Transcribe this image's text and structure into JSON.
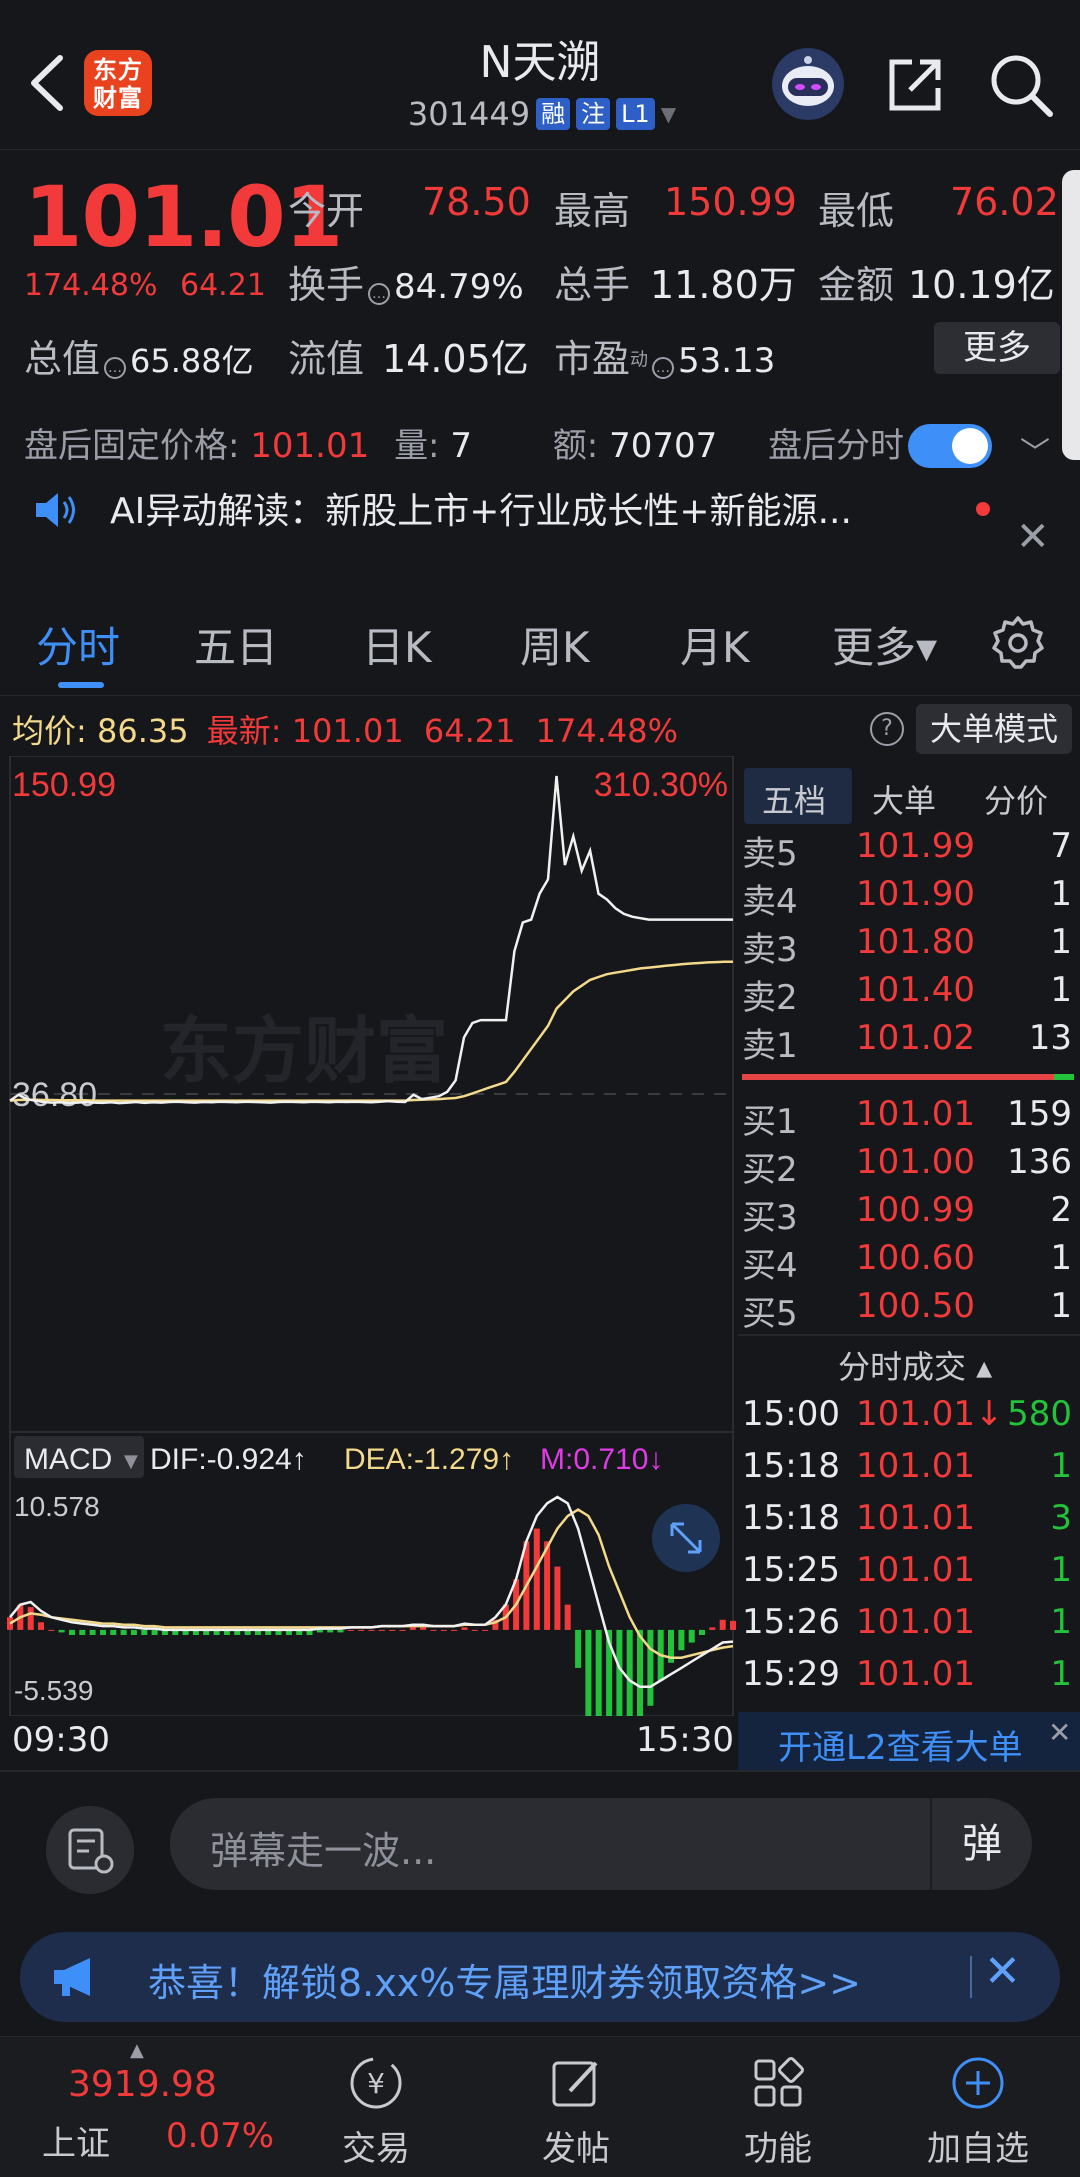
{
  "header": {
    "logo_text": "东方\n财富",
    "stock_name": "N天溯",
    "stock_code": "301449",
    "tags": [
      "融",
      "注",
      "L1"
    ]
  },
  "quote": {
    "price": "101.01",
    "change_pct": "174.48%",
    "change_abs": "64.21",
    "open_label": "今开",
    "open": "78.50",
    "high_label": "最高",
    "high": "150.99",
    "low_label": "最低",
    "low": "76.02",
    "turnover_label": "换手",
    "turnover": "84.79%",
    "volume_label": "总手",
    "volume": "11.80万",
    "amount_label": "金额",
    "amount": "10.19亿",
    "mktcap_label": "总值",
    "mktcap": "65.88亿",
    "float_label": "流值",
    "float": "14.05亿",
    "pe_label": "市盈",
    "pe_sup": "动",
    "pe": "53.13",
    "more_label": "更多"
  },
  "after_hours": {
    "price_label": "盘后固定价格:",
    "price": "101.01",
    "vol_label": "量:",
    "vol": "7",
    "amt_label": "额:",
    "amt": "70707",
    "toggle_label": "盘后分时",
    "toggle_on": true
  },
  "ai": {
    "text": "AI异动解读：新股上市+行业成长性+新能源..."
  },
  "tabs": [
    {
      "label": "分时",
      "active": true
    },
    {
      "label": "五日"
    },
    {
      "label": "日K"
    },
    {
      "label": "周K"
    },
    {
      "label": "月K"
    },
    {
      "label": "更多▾"
    }
  ],
  "avg_row": {
    "avg_label": "均价:",
    "avg": "86.35",
    "latest_label": "最新:",
    "latest": "101.01",
    "latest_chg": "64.21",
    "latest_pct": "174.48%",
    "help": "?",
    "bigorder_label": "大单模式"
  },
  "chart_data": {
    "type": "line",
    "price_top": "150.99",
    "pct_top": "310.30%",
    "price_mid": "36.80",
    "watermark": "东方财富",
    "time_start": "09:30",
    "time_end": "15:30",
    "macd_label": "MACD",
    "dif": "DIF:-0.924↑",
    "dea": "DEA:-1.279↑",
    "m": "M:0.710↓",
    "macd_top": "10.578",
    "macd_bottom": "-5.539",
    "price_series": [
      38,
      40,
      38.5,
      38,
      37.5,
      37.3,
      37.4,
      37.2,
      37.3,
      37.5,
      37.3,
      37.2,
      37.4,
      37.1,
      37.3,
      37.5,
      37.2,
      37.4,
      37.3,
      37.5,
      37.6,
      37.4,
      37.3,
      37.5,
      37.4,
      37.6,
      37.5,
      37.4,
      37.6,
      37.5,
      37.4,
      37.3,
      37.5,
      37.6,
      37.5,
      37.4,
      37.6,
      37.5,
      37.4,
      37.6,
      37.5,
      37.6,
      37.5,
      37.4,
      37.6,
      37.8,
      37.6,
      37.5,
      40,
      38.5,
      39,
      39.5,
      41,
      45,
      60,
      65,
      66,
      66,
      66,
      66,
      90,
      100,
      101,
      110,
      115,
      150.99,
      120,
      130,
      118,
      125,
      110,
      108,
      105,
      103,
      102,
      101.5,
      101,
      101,
      101,
      101,
      101,
      101,
      101,
      101,
      101,
      101,
      101.01
    ],
    "avg_series": [
      38,
      38.2,
      38.3,
      38.3,
      38.2,
      38.2,
      38.1,
      38.1,
      38.1,
      38.1,
      38,
      38,
      38,
      38,
      38,
      38,
      38,
      38,
      38,
      38,
      38,
      38,
      38,
      38,
      38,
      38,
      38,
      38,
      38,
      38,
      38,
      38,
      38,
      38,
      38,
      38,
      38,
      38,
      38,
      38,
      38,
      38,
      38,
      38,
      38,
      38,
      38,
      38,
      38.2,
      38.3,
      38.4,
      38.5,
      38.7,
      38.9,
      39.5,
      40.5,
      41.5,
      42.5,
      43.5,
      44.5,
      48,
      52,
      56,
      60,
      64,
      70,
      73,
      76,
      78,
      80,
      81,
      82,
      82.5,
      83,
      83.5,
      84,
      84.3,
      84.6,
      84.9,
      85.2,
      85.5,
      85.7,
      85.9,
      86.1,
      86.2,
      86.3,
      86.35
    ],
    "dif_series": [
      1,
      2,
      2.2,
      1.5,
      1,
      0.8,
      0.6,
      0.5,
      0.4,
      0.3,
      0.3,
      0.2,
      0.2,
      0.1,
      0.1,
      0,
      0,
      0,
      0,
      0,
      0,
      0,
      0,
      0,
      0,
      0,
      0,
      0,
      0,
      0,
      0.1,
      0.1,
      0.1,
      0.2,
      0.2,
      0.2,
      0.3,
      0.3,
      0.3,
      0.4,
      0.4,
      0.3,
      0.3,
      0.3,
      0.5,
      0.4,
      0.4,
      1,
      2,
      4,
      7,
      9,
      10,
      10.5,
      10,
      8,
      5,
      2,
      -1,
      -3,
      -4,
      -4.5,
      -4.5,
      -4,
      -3.5,
      -3,
      -2.5,
      -2,
      -1.5,
      -1,
      -0.924
    ],
    "dea_series": [
      0.5,
      1,
      1.3,
      1.2,
      1,
      0.9,
      0.8,
      0.7,
      0.6,
      0.5,
      0.5,
      0.4,
      0.4,
      0.3,
      0.3,
      0.2,
      0.2,
      0.2,
      0.2,
      0.2,
      0.2,
      0.2,
      0.2,
      0.2,
      0.2,
      0.2,
      0.2,
      0.2,
      0.2,
      0.2,
      0.2,
      0.2,
      0.2,
      0.2,
      0.2,
      0.2,
      0.3,
      0.3,
      0.3,
      0.3,
      0.3,
      0.3,
      0.3,
      0.3,
      0.4,
      0.4,
      0.4,
      0.6,
      1,
      2,
      3.5,
      5,
      6.5,
      8,
      9,
      9.5,
      9,
      7.5,
      5,
      3,
      1,
      -0.5,
      -1.5,
      -2,
      -2.2,
      -2.2,
      -2,
      -1.8,
      -1.6,
      -1.4,
      -1.279
    ]
  },
  "order_book": {
    "tabs": [
      "五档",
      "大单",
      "分价"
    ],
    "asks": [
      {
        "label": "卖5",
        "price": "101.99",
        "vol": "7"
      },
      {
        "label": "卖4",
        "price": "101.90",
        "vol": "1"
      },
      {
        "label": "卖3",
        "price": "101.80",
        "vol": "1"
      },
      {
        "label": "卖2",
        "price": "101.40",
        "vol": "1"
      },
      {
        "label": "卖1",
        "price": "101.02",
        "vol": "13"
      }
    ],
    "bids": [
      {
        "label": "买1",
        "price": "101.01",
        "vol": "159"
      },
      {
        "label": "买2",
        "price": "101.00",
        "vol": "136"
      },
      {
        "label": "买3",
        "price": "100.99",
        "vol": "2"
      },
      {
        "label": "买4",
        "price": "100.60",
        "vol": "1"
      },
      {
        "label": "买5",
        "price": "100.50",
        "vol": "1"
      }
    ],
    "ticks_title": "分时成交 ▴",
    "ticks": [
      {
        "time": "15:00",
        "price": "101.01↓",
        "vol": "580",
        "side": "green"
      },
      {
        "time": "15:18",
        "price": "101.01",
        "vol": "1",
        "side": "green"
      },
      {
        "time": "15:18",
        "price": "101.01",
        "vol": "3",
        "side": "green"
      },
      {
        "time": "15:25",
        "price": "101.01",
        "vol": "1",
        "side": "green"
      },
      {
        "time": "15:26",
        "price": "101.01",
        "vol": "1",
        "side": "green"
      },
      {
        "time": "15:29",
        "price": "101.01",
        "vol": "1",
        "side": "green"
      }
    ],
    "l2_text": "开通L2查看大单"
  },
  "danmaku": {
    "placeholder": "弹幕走一波...",
    "send": "弹"
  },
  "banner": {
    "text": "恭喜！解锁8.xx%专属理财券领取资格>>"
  },
  "bottom_nav": {
    "index_value": "3919.98",
    "index_name": "上证",
    "index_pct": "0.07%",
    "items": [
      {
        "label": "交易"
      },
      {
        "label": "发帖"
      },
      {
        "label": "功能"
      },
      {
        "label": "加自选"
      }
    ]
  },
  "colors": {
    "up": "#f23a3a",
    "down": "#22c23b",
    "accent": "#3e8ff7",
    "avg_line": "#f3d98a",
    "bg": "#16171b"
  }
}
